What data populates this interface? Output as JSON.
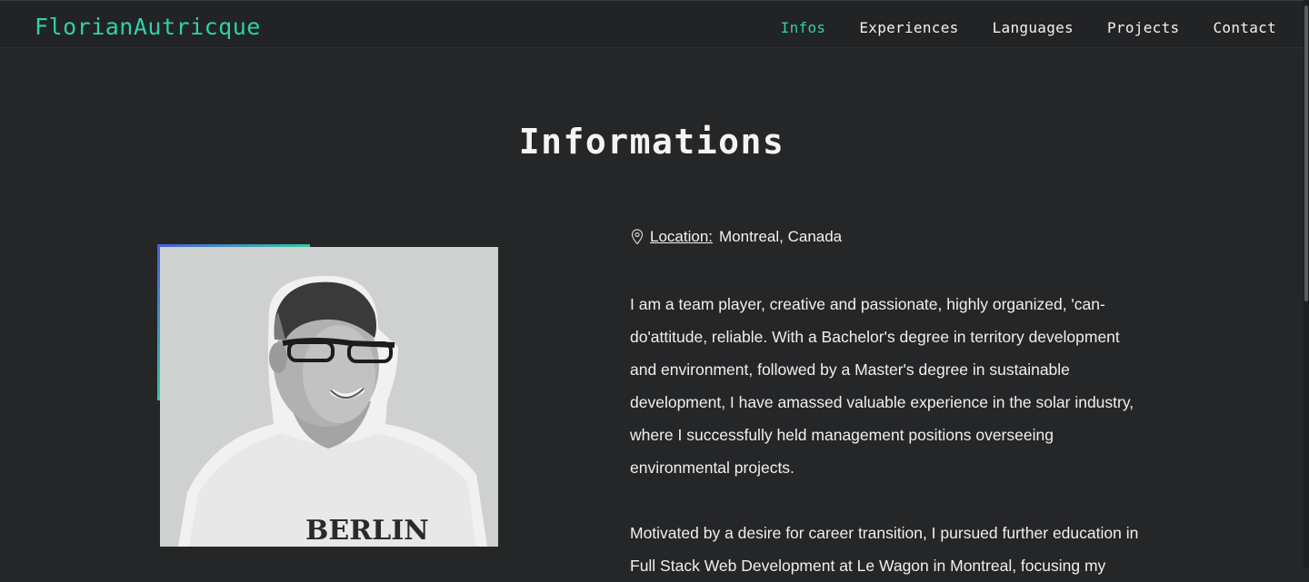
{
  "nav": {
    "brand": "FlorianAutricque",
    "links": [
      {
        "label": "Infos",
        "active": true
      },
      {
        "label": "Experiences",
        "active": false
      },
      {
        "label": "Languages",
        "active": false
      },
      {
        "label": "Projects",
        "active": false
      },
      {
        "label": "Contact",
        "active": false
      }
    ]
  },
  "section": {
    "title": "Informations"
  },
  "info": {
    "location_icon": "map-pin-icon",
    "location_label": "Location:",
    "location_value": "Montreal, Canada",
    "paragraphs": [
      "I am a team player, creative and passionate, highly organized, 'can-do'attitude, reliable. With a Bachelor's degree in territory development and environment, followed by a Master's degree in sustainable development, I have amassed valuable experience in the solar industry, where I successfully held management positions overseeing environmental projects.",
      "Motivated by a desire for career transition, I pursued further education in Full Stack Web Development at Le Wagon in Montreal, focusing my"
    ]
  },
  "photo": {
    "shirt_text": "BERLIN"
  },
  "colors": {
    "accent": "#2fd0a9",
    "background": "#252628",
    "navbar": "#222325",
    "gradient_start": "#4a5fd8",
    "gradient_end": "#35c7a3"
  }
}
